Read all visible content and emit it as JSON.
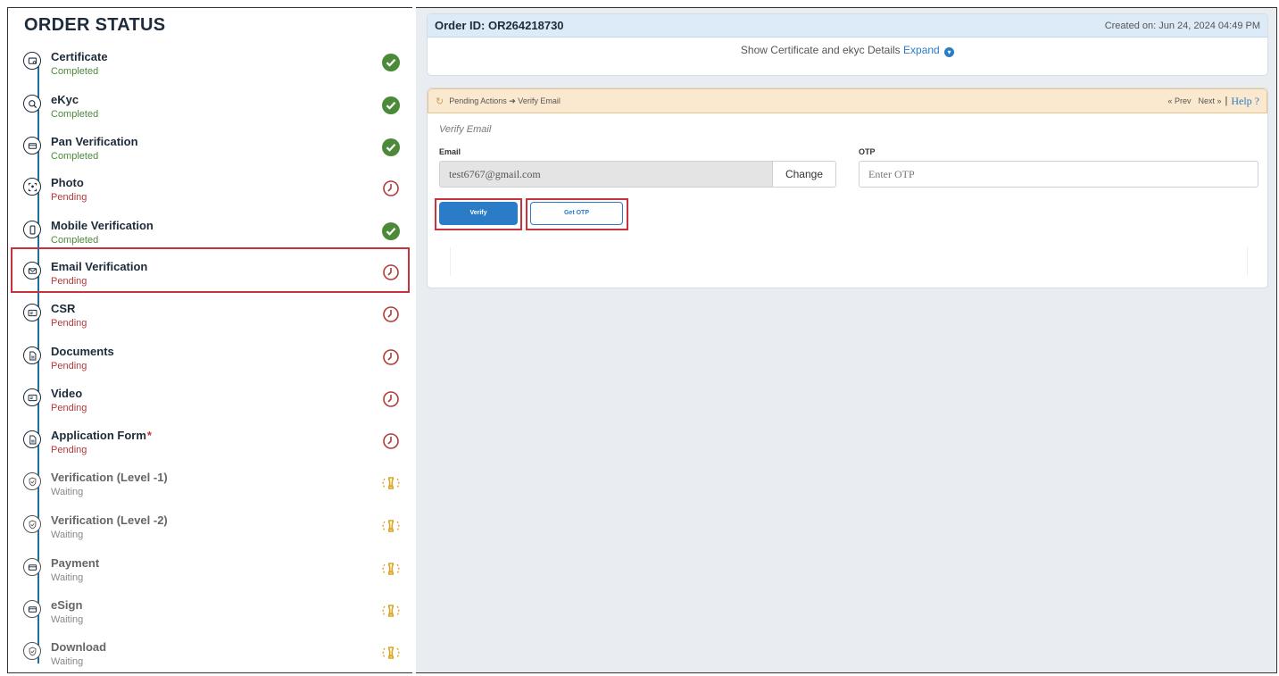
{
  "sidebar": {
    "title": "ORDER STATUS",
    "steps": [
      {
        "name": "Certificate",
        "status": "Completed",
        "state": "completed",
        "icon": "certificate-icon"
      },
      {
        "name": "eKyc",
        "status": "Completed",
        "state": "completed",
        "icon": "magnifier-user-icon"
      },
      {
        "name": "Pan Verification",
        "status": "Completed",
        "state": "completed",
        "icon": "card-icon"
      },
      {
        "name": "Photo",
        "status": "Pending",
        "state": "pending",
        "icon": "face-scan-icon"
      },
      {
        "name": "Mobile Verification",
        "status": "Completed",
        "state": "completed",
        "icon": "mobile-icon"
      },
      {
        "name": "Email Verification",
        "status": "Pending",
        "state": "pending",
        "icon": "envelope-icon"
      },
      {
        "name": "CSR",
        "status": "Pending",
        "state": "pending",
        "icon": "id-card-icon"
      },
      {
        "name": "Documents",
        "status": "Pending",
        "state": "pending",
        "icon": "document-icon"
      },
      {
        "name": "Video",
        "status": "Pending",
        "state": "pending",
        "icon": "id-card-icon"
      },
      {
        "name": "Application Form",
        "status": "Pending",
        "state": "pending",
        "icon": "document-icon",
        "required_mark": "*"
      },
      {
        "name": "Verification (Level -1)",
        "status": "Waiting",
        "state": "waiting",
        "icon": "shield-check-icon"
      },
      {
        "name": "Verification (Level -2)",
        "status": "Waiting",
        "state": "waiting",
        "icon": "shield-check-icon"
      },
      {
        "name": "Payment",
        "status": "Waiting",
        "state": "waiting",
        "icon": "card-icon"
      },
      {
        "name": "eSign",
        "status": "Waiting",
        "state": "waiting",
        "icon": "card-icon"
      },
      {
        "name": "Download",
        "status": "Waiting",
        "state": "waiting",
        "icon": "shield-check-icon"
      }
    ]
  },
  "order": {
    "id_label": "Order ID: OR264218730",
    "created_on": "Created on: Jun 24, 2024 04:49 PM",
    "expand_text": "Show Certificate and ekyc Details",
    "expand_link": "Expand"
  },
  "pending_actions": {
    "breadcrumb": "Pending Actions ➔ Verify Email",
    "prev_label": "Prev",
    "next_label": "Next",
    "help_label": "Help ?"
  },
  "verify_email": {
    "heading": "Verify Email",
    "email_label": "Email",
    "email_value": "test6767@gmail.com",
    "change_label": "Change",
    "otp_label": "OTP",
    "otp_placeholder": "Enter OTP",
    "verify_label": "Verify",
    "get_otp_label": "Get OTP"
  },
  "colors": {
    "accent": "#2a7cc7",
    "completed": "#4c8a3a",
    "pending": "#b23a3a",
    "waiting": "#d9a521",
    "highlight": "#c8323c"
  }
}
